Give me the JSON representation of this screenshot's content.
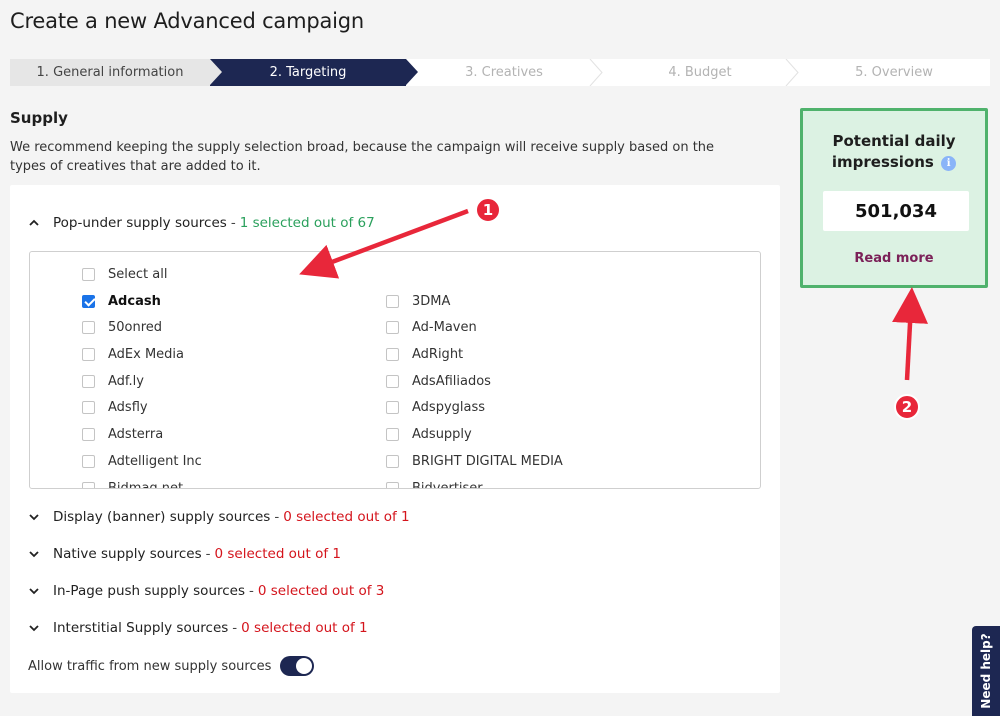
{
  "page": {
    "title": "Create a new Advanced campaign"
  },
  "stepper": {
    "steps": [
      {
        "label": "1. General information",
        "state": "done"
      },
      {
        "label": "2. Targeting",
        "state": "active"
      },
      {
        "label": "3. Creatives",
        "state": "upcoming"
      },
      {
        "label": "4. Budget",
        "state": "upcoming"
      },
      {
        "label": "5. Overview",
        "state": "upcoming"
      }
    ]
  },
  "supply": {
    "title": "Supply",
    "description": "We recommend keeping the supply selection broad, because the campaign will receive supply based on the types of creatives that are added to it.",
    "popunder": {
      "label": "Pop-under supply sources",
      "sep": "-",
      "count": "1 selected out of 67",
      "expanded": true,
      "select_all": "Select all",
      "left_items": [
        {
          "label": "Adcash",
          "checked": true
        },
        {
          "label": "50onred",
          "checked": false
        },
        {
          "label": "AdEx Media",
          "checked": false
        },
        {
          "label": "Adf.ly",
          "checked": false
        },
        {
          "label": "Adsfly",
          "checked": false
        },
        {
          "label": "Adsterra",
          "checked": false
        },
        {
          "label": "Adtelligent Inc",
          "checked": false
        },
        {
          "label": "Bidmag.net",
          "checked": false
        }
      ],
      "right_items": [
        {
          "label": "3DMA",
          "checked": false
        },
        {
          "label": "Ad-Maven",
          "checked": false
        },
        {
          "label": "AdRight",
          "checked": false
        },
        {
          "label": "AdsAfiliados",
          "checked": false
        },
        {
          "label": "Adspyglass",
          "checked": false
        },
        {
          "label": "Adsupply",
          "checked": false
        },
        {
          "label": "BRIGHT DIGITAL MEDIA",
          "checked": false
        },
        {
          "label": "Bidvertiser",
          "checked": false
        }
      ]
    },
    "groups": [
      {
        "label": "Display (banner) supply sources",
        "sep": "-",
        "count": "0 selected out of 1"
      },
      {
        "label": "Native supply sources",
        "sep": "-",
        "count": "0 selected out of 1"
      },
      {
        "label": "In-Page push supply sources",
        "sep": "-",
        "count": "0 selected out of 3"
      },
      {
        "label": "Interstitial Supply sources",
        "sep": "-",
        "count": "0 selected out of 1"
      }
    ],
    "new_sources_toggle": {
      "label": "Allow traffic from new supply sources",
      "on": true
    }
  },
  "impressions": {
    "title_line1": "Potential daily",
    "title_line2": "impressions",
    "info_icon": "i",
    "value": "501,034",
    "read_more": "Read more"
  },
  "help": {
    "label": "Need help?"
  },
  "annotations": {
    "badge1": "1",
    "badge2": "2",
    "color": "#e8273a"
  },
  "colors": {
    "navy": "#1d2752",
    "green": "#2aa05c",
    "red": "#d4141c",
    "highlight_border": "#4fb26c"
  }
}
